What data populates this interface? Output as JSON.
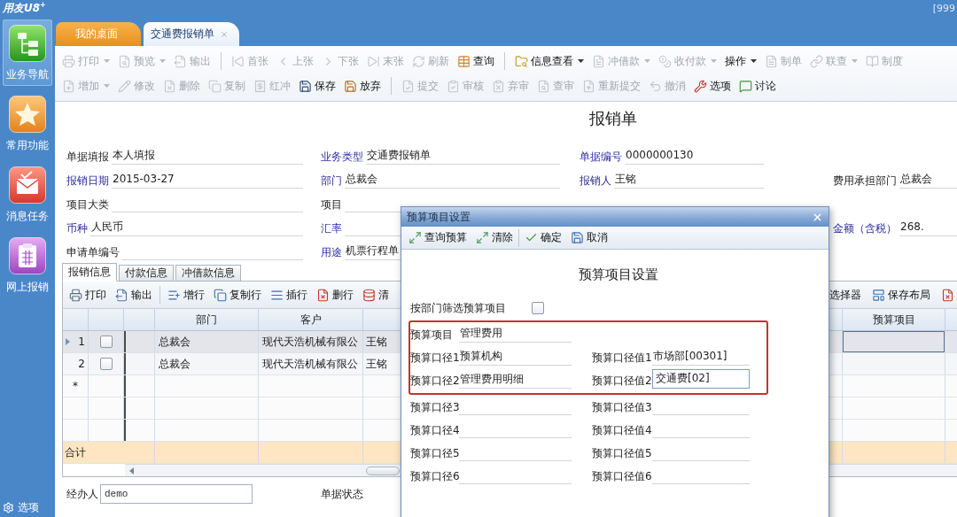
{
  "app": {
    "logo": "用友U8$^{+}$",
    "account": "[999"
  },
  "sidebar": {
    "items": [
      {
        "label": "业务导航",
        "selected": true
      },
      {
        "label": "常用功能",
        "selected": false
      },
      {
        "label": "消息任务",
        "selected": false
      },
      {
        "label": "网上报销",
        "selected": false
      }
    ],
    "footer": "选项"
  },
  "tabs": [
    {
      "label": "我的桌面",
      "selected": false,
      "closable": false
    },
    {
      "label": "交通费报销单",
      "selected": true,
      "closable": true
    }
  ],
  "toolbar": [
    {
      "groups": [
        [
          {
            "label": "打印",
            "kind": "icon_text",
            "disabled": true,
            "dropdown": true
          },
          {
            "label": "预览",
            "kind": "icon_text",
            "disabled": true,
            "dropdown": true
          },
          {
            "label": "输出",
            "kind": "icon_text",
            "disabled": true,
            "dropdown": false
          }
        ],
        [
          {
            "label": "首张",
            "kind": "icon_text",
            "disabled": true,
            "dropdown": false
          },
          {
            "label": "上张",
            "kind": "icon_text",
            "disabled": true,
            "dropdown": false
          },
          {
            "label": "下张",
            "kind": "icon_text",
            "disabled": true,
            "dropdown": false
          },
          {
            "label": "末张",
            "kind": "icon_text",
            "disabled": true,
            "dropdown": false
          },
          {
            "label": "刷新",
            "kind": "icon_text",
            "disabled": true,
            "dropdown": false
          },
          {
            "label": "查询",
            "kind": "icon_text",
            "disabled": false,
            "dropdown": false
          }
        ],
        [
          {
            "label": "信息查看",
            "kind": "icon_text",
            "disabled": false,
            "dropdown": true
          },
          {
            "label": "冲借款",
            "kind": "icon_text",
            "disabled": true,
            "dropdown": true
          },
          {
            "label": "收付款",
            "kind": "icon_text",
            "disabled": true,
            "dropdown": true
          },
          {
            "label": "操作",
            "kind": "text",
            "disabled": false,
            "dropdown": true
          },
          {
            "label": "制单",
            "kind": "icon_text",
            "disabled": true,
            "dropdown": false
          },
          {
            "label": "联查",
            "kind": "icon_text",
            "disabled": true,
            "dropdown": true
          },
          {
            "label": "制度",
            "kind": "icon_text",
            "disabled": true,
            "dropdown": false
          }
        ]
      ]
    },
    {
      "groups": [
        [
          {
            "label": "增加",
            "kind": "icon_text",
            "disabled": true,
            "dropdown": true
          },
          {
            "label": "修改",
            "kind": "icon_text",
            "disabled": true,
            "dropdown": false
          },
          {
            "label": "删除",
            "kind": "icon_text",
            "disabled": true,
            "dropdown": false
          },
          {
            "label": "复制",
            "kind": "icon_text",
            "disabled": true,
            "dropdown": false
          },
          {
            "label": "红冲",
            "kind": "icon_text",
            "disabled": true,
            "dropdown": false
          },
          {
            "label": "保存",
            "kind": "icon_text",
            "disabled": false,
            "dropdown": false
          },
          {
            "label": "放弃",
            "kind": "icon_text",
            "disabled": false,
            "dropdown": false
          }
        ],
        [
          {
            "label": "提交",
            "kind": "icon_text",
            "disabled": true,
            "dropdown": false
          },
          {
            "label": "审核",
            "kind": "icon_text",
            "disabled": true,
            "dropdown": false
          },
          {
            "label": "弃审",
            "kind": "icon_text",
            "disabled": true,
            "dropdown": false
          },
          {
            "label": "查审",
            "kind": "icon_text",
            "disabled": true,
            "dropdown": false
          },
          {
            "label": "重新提交",
            "kind": "icon_text",
            "disabled": true,
            "dropdown": false
          },
          {
            "label": "撤消",
            "kind": "icon_text",
            "disabled": true,
            "dropdown": false
          },
          {
            "label": "选项",
            "kind": "icon_text",
            "disabled": false,
            "dropdown": false
          },
          {
            "label": "讨论",
            "kind": "icon_text",
            "disabled": false,
            "dropdown": false
          }
        ]
      ]
    }
  ],
  "document": {
    "title": "报销单",
    "form": [
      {
        "column_1": {
          "label": "单据填报",
          "value": "本人填报",
          "required": false
        },
        "column_2": {
          "label": "业务类型",
          "value": "交通费报销单",
          "required": true
        },
        "column_3": {
          "label": "单据编号",
          "value": "0000000130",
          "required": true
        }
      },
      {
        "column_1": {
          "label": "报销日期",
          "value": "2015-03-27",
          "required": true
        },
        "column_2": {
          "label": "部门",
          "value": "总裁会",
          "required": true
        },
        "column_3": {
          "label": "报销人",
          "value": "王铭",
          "required": true
        },
        "column_4": {
          "label": "费用承担部门",
          "value": "总裁会",
          "required": false
        }
      },
      {
        "column_1": {
          "label": "项目大类",
          "required": false
        },
        "column_2": {
          "label": "项目",
          "required": false
        }
      },
      {
        "column_1": {
          "label": "币种",
          "value": "人民币",
          "required": true
        },
        "column_2": {
          "label": "汇率",
          "required": true
        },
        "column_4": {
          "label": "金额（含税）",
          "value": "268.",
          "required": true
        }
      },
      {
        "column_1": {
          "label": "申请单编号",
          "required": false
        },
        "column_2": {
          "label": "用途",
          "value": "机票行程单",
          "required": true
        }
      }
    ],
    "tabs": [
      {
        "label": "报销信息",
        "selected": true
      },
      {
        "label": "付款信息",
        "selected": false
      },
      {
        "label": "冲借款信息",
        "selected": false
      }
    ],
    "grid_toolbar": {
      "left": [
        [
          {
            "label": "打印",
            "kind": "icon_text"
          },
          {
            "label": "输出",
            "kind": "icon_text"
          }
        ],
        [
          {
            "label": "增行",
            "kind": "icon_text"
          },
          {
            "label": "复制行",
            "kind": "icon_text"
          },
          {
            "label": "插行",
            "kind": "icon_text"
          },
          {
            "label": "删行",
            "kind": "icon_text"
          },
          {
            "label": "清",
            "kind": "icon_text"
          }
        ]
      ],
      "right": [
        {
          "label": "选择器",
          "kind": "text"
        },
        {
          "label": "保存布局",
          "kind": "icon_text"
        },
        {
          "kind": "icon"
        }
      ]
    },
    "grid": {
      "headers": {
        "department": "部门",
        "customer": "客户",
        "budget_item": "预算项目"
      },
      "rows": [
        {
          "kind": "data",
          "number": "1",
          "selected": true,
          "checked": false,
          "department": "总裁会",
          "customer": "现代天浩机械有限公",
          "column_6": "王铭"
        },
        {
          "kind": "data",
          "number": "2",
          "selected": false,
          "checked": false,
          "department": "总裁会",
          "customer": "现代天浩机械有限公",
          "column_6": "王铭"
        },
        {
          "kind": "new",
          "number": "*",
          "selected": false
        }
      ],
      "total": "合计"
    },
    "footer": [
      {
        "label": "经办人",
        "kind": "input",
        "value": "demo"
      },
      {
        "label": "单据状态",
        "kind": "label"
      }
    ]
  },
  "dialog": {
    "title": "预算项目设置",
    "toolbar": [
      [
        {
          "label": "查询预算"
        },
        {
          "label": "清除"
        }
      ],
      [
        {
          "label": "确定"
        },
        {
          "label": "取消"
        }
      ]
    ],
    "heading": "预算项目设置",
    "filter": {
      "label": "按部门筛选预算项目",
      "checked": false
    },
    "groups": [
      {
        "highlighted": true,
        "rows": [
          {
            "left": {
              "label": "预算项目",
              "value": "管理费用",
              "focused": false
            }
          },
          {
            "left": {
              "label": "预算口径1",
              "value": "预算机构",
              "focused": false
            },
            "right": {
              "label": "预算口径值1",
              "value": "市场部[00301]",
              "focused": false
            }
          },
          {
            "left": {
              "label": "预算口径2",
              "value": "管理费用明细",
              "focused": false
            },
            "right": {
              "label": "预算口径值2",
              "value": "交通费[02]",
              "focused": true
            }
          }
        ]
      },
      {
        "highlighted": false,
        "rows": [
          {
            "left": {
              "label": "预算口径3",
              "focused": false
            },
            "right": {
              "label": "预算口径值3",
              "focused": false
            }
          },
          {
            "left": {
              "label": "预算口径4",
              "focused": false
            },
            "right": {
              "label": "预算口径值4",
              "focused": false
            }
          },
          {
            "left": {
              "label": "预算口径5",
              "focused": false
            },
            "right": {
              "label": "预算口径值5",
              "focused": false
            }
          },
          {
            "left": {
              "label": "预算口径6",
              "focused": false
            },
            "right": {
              "label": "预算口径值6",
              "focused": false
            }
          }
        ]
      }
    ]
  }
}
